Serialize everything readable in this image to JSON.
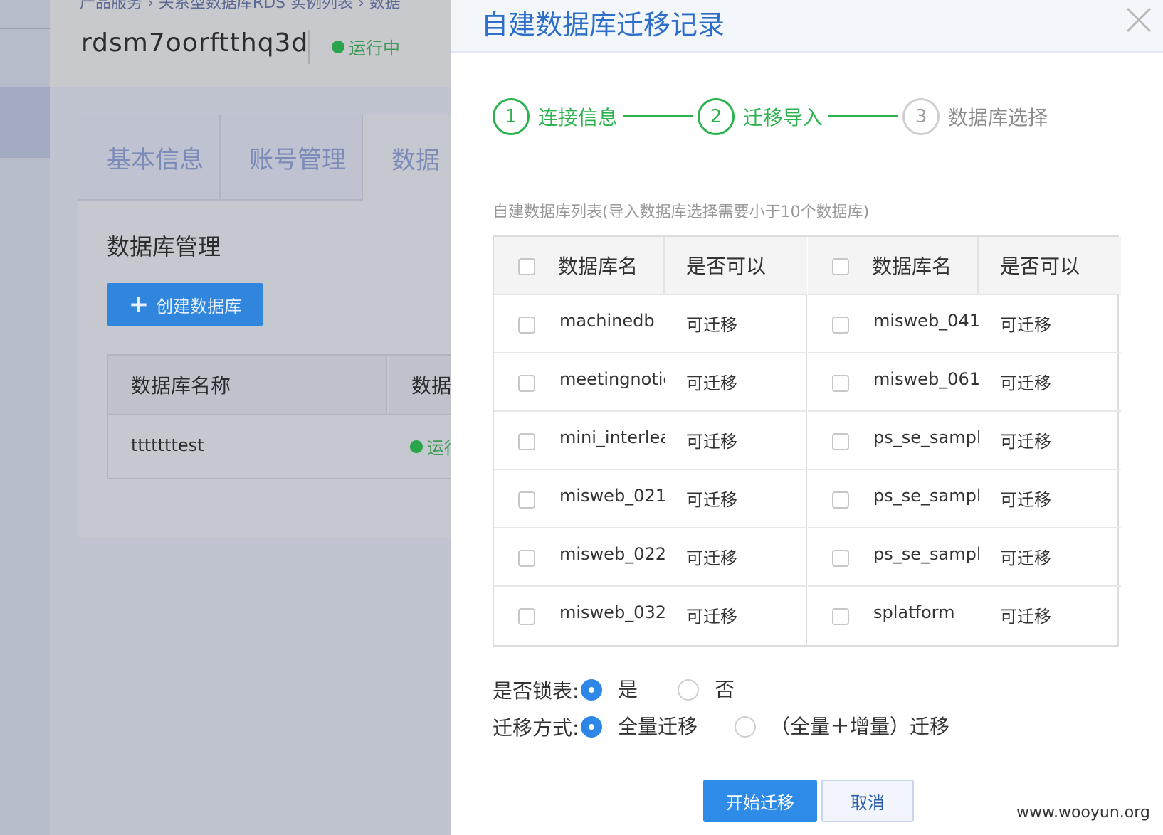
{
  "background": {
    "breadcrumb": "产品服务  ›  关系型数据库RDS  实例列表  ›  数据",
    "instance_name": "rdsm7oorftthq3d",
    "instance_status": "运行中",
    "tabs": [
      "基本信息",
      "账号管理",
      "数据"
    ],
    "section_title": "数据库管理",
    "create_button": "创建数据库",
    "table_headers": [
      "数据库名称",
      "数据"
    ],
    "table_row": {
      "name": "tttttttest",
      "status": "运行"
    }
  },
  "modal": {
    "title": "自建数据库迁移记录",
    "steps": [
      {
        "num": "1",
        "label": "连接信息",
        "state": "done"
      },
      {
        "num": "2",
        "label": "迁移导入",
        "state": "done"
      },
      {
        "num": "3",
        "label": "数据库选择",
        "state": "inactive"
      }
    ],
    "list_caption": "自建数据库列表(导入数据库选择需要小于10个数据库)",
    "columns": {
      "name": "数据库名",
      "can_migrate": "是否可以"
    },
    "left_rows": [
      {
        "name": "machinedb",
        "status": "可迁移"
      },
      {
        "name": "meetingnoticmeetingnotic",
        "status": "可迁移"
      },
      {
        "name": "mini_interleave",
        "status": "可迁移"
      },
      {
        "name": "misweb_021",
        "status": "可迁移"
      },
      {
        "name": "misweb_022",
        "status": "可迁移"
      },
      {
        "name": "misweb_032",
        "status": "可迁移"
      }
    ],
    "right_rows": [
      {
        "name": "misweb_041",
        "status": "可迁移"
      },
      {
        "name": "misweb_061",
        "status": "可迁移"
      },
      {
        "name": "ps_se_sample",
        "status": "可迁移"
      },
      {
        "name": "ps_se_sample",
        "status": "可迁移"
      },
      {
        "name": "ps_se_sample",
        "status": "可迁移"
      },
      {
        "name": "splatform",
        "status": "可迁移"
      }
    ],
    "lock_table": {
      "label": "是否锁表:",
      "options": [
        "是",
        "否"
      ],
      "selected": "是"
    },
    "migration_mode": {
      "label": "迁移方式:",
      "options": [
        "全量迁移",
        "（全量＋增量）迁移"
      ],
      "selected": "全量迁移"
    },
    "start_button": "开始迁移",
    "cancel_button": "取消"
  },
  "watermark": "www.wooyun.org",
  "colors": {
    "accent_blue": "#2f8be8",
    "step_green": "#2cb34f",
    "status_green": "#2aa54b"
  }
}
